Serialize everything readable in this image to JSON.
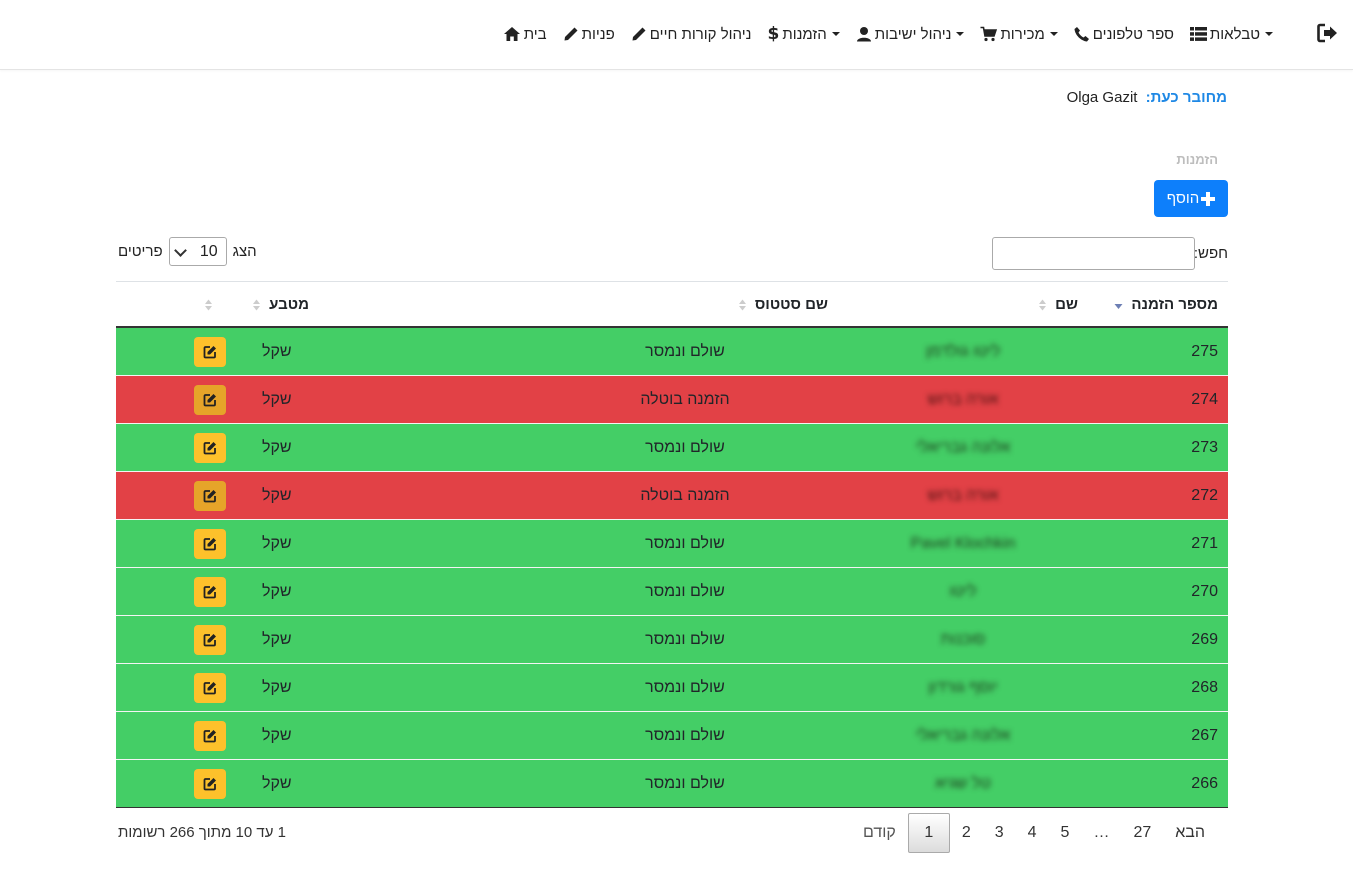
{
  "nav": {
    "items": [
      {
        "label": "בית",
        "icon": "home-icon"
      },
      {
        "label": "פניות",
        "icon": "pencil-icon"
      },
      {
        "label": "ניהול קורות חיים",
        "icon": "pencil-icon"
      },
      {
        "label": "הזמנות",
        "icon": "dollar-icon",
        "dropdown": true
      },
      {
        "label": "ניהול ישיבות",
        "icon": "user-icon",
        "dropdown": true
      },
      {
        "label": "מכירות",
        "icon": "cart-icon",
        "dropdown": true
      },
      {
        "label": "ספר טלפונים",
        "icon": "phone-icon"
      },
      {
        "label": "טבלאות",
        "icon": "list-icon",
        "dropdown": true
      }
    ],
    "logout_icon": "logout-icon"
  },
  "user": {
    "connected_label": "מחובר כעת:",
    "name": "Olga Gazit"
  },
  "page": {
    "title": "הזמנות",
    "add_label": "הוסף"
  },
  "controls": {
    "search_label": "חפש:",
    "search_value": "",
    "show_label": "הצג",
    "show_value": "10",
    "items_label": "פריטים"
  },
  "table": {
    "headers": [
      "מספר הזמנה",
      "שם",
      "שם סטטוס",
      "מטבע",
      ""
    ],
    "rows": [
      {
        "num": "275",
        "name": "ליטו גולדמן",
        "status": "שולם ונמסר",
        "currency": "שקל",
        "color": "green"
      },
      {
        "num": "274",
        "name": "אורה ברוש",
        "status": "הזמנה בוטלה",
        "currency": "שקל",
        "color": "red"
      },
      {
        "num": "273",
        "name": "אלונה גבריאלי",
        "status": "שולם ונמסר",
        "currency": "שקל",
        "color": "green"
      },
      {
        "num": "272",
        "name": "אורה ברוש",
        "status": "הזמנה בוטלה",
        "currency": "שקל",
        "color": "red"
      },
      {
        "num": "271",
        "name": "Pavel Klochkin",
        "status": "שולם ונמסר",
        "currency": "שקל",
        "color": "green"
      },
      {
        "num": "270",
        "name": "ליטו",
        "status": "שולם ונמסר",
        "currency": "שקל",
        "color": "green"
      },
      {
        "num": "269",
        "name": "סוכנות",
        "status": "שולם ונמסר",
        "currency": "שקל",
        "color": "green"
      },
      {
        "num": "268",
        "name": "יוסף גורדון",
        "status": "שולם ונמסר",
        "currency": "שקל",
        "color": "green"
      },
      {
        "num": "267",
        "name": "אלונה גבריאלי",
        "status": "שולם ונמסר",
        "currency": "שקל",
        "color": "green"
      },
      {
        "num": "266",
        "name": "טל שגיא",
        "status": "שולם ונמסר",
        "currency": "שקל",
        "color": "green"
      }
    ]
  },
  "pagination": {
    "prev": "קודם",
    "pages": [
      "1",
      "2",
      "3",
      "4",
      "5",
      "…",
      "27"
    ],
    "active": "1",
    "next": "הבא",
    "info": "1 עד 10 מתוך 266 רשומות"
  },
  "colors": {
    "green": "#44ce66",
    "red": "#e24146",
    "primary": "#0d7ffb",
    "edit": "#fdc12b"
  }
}
